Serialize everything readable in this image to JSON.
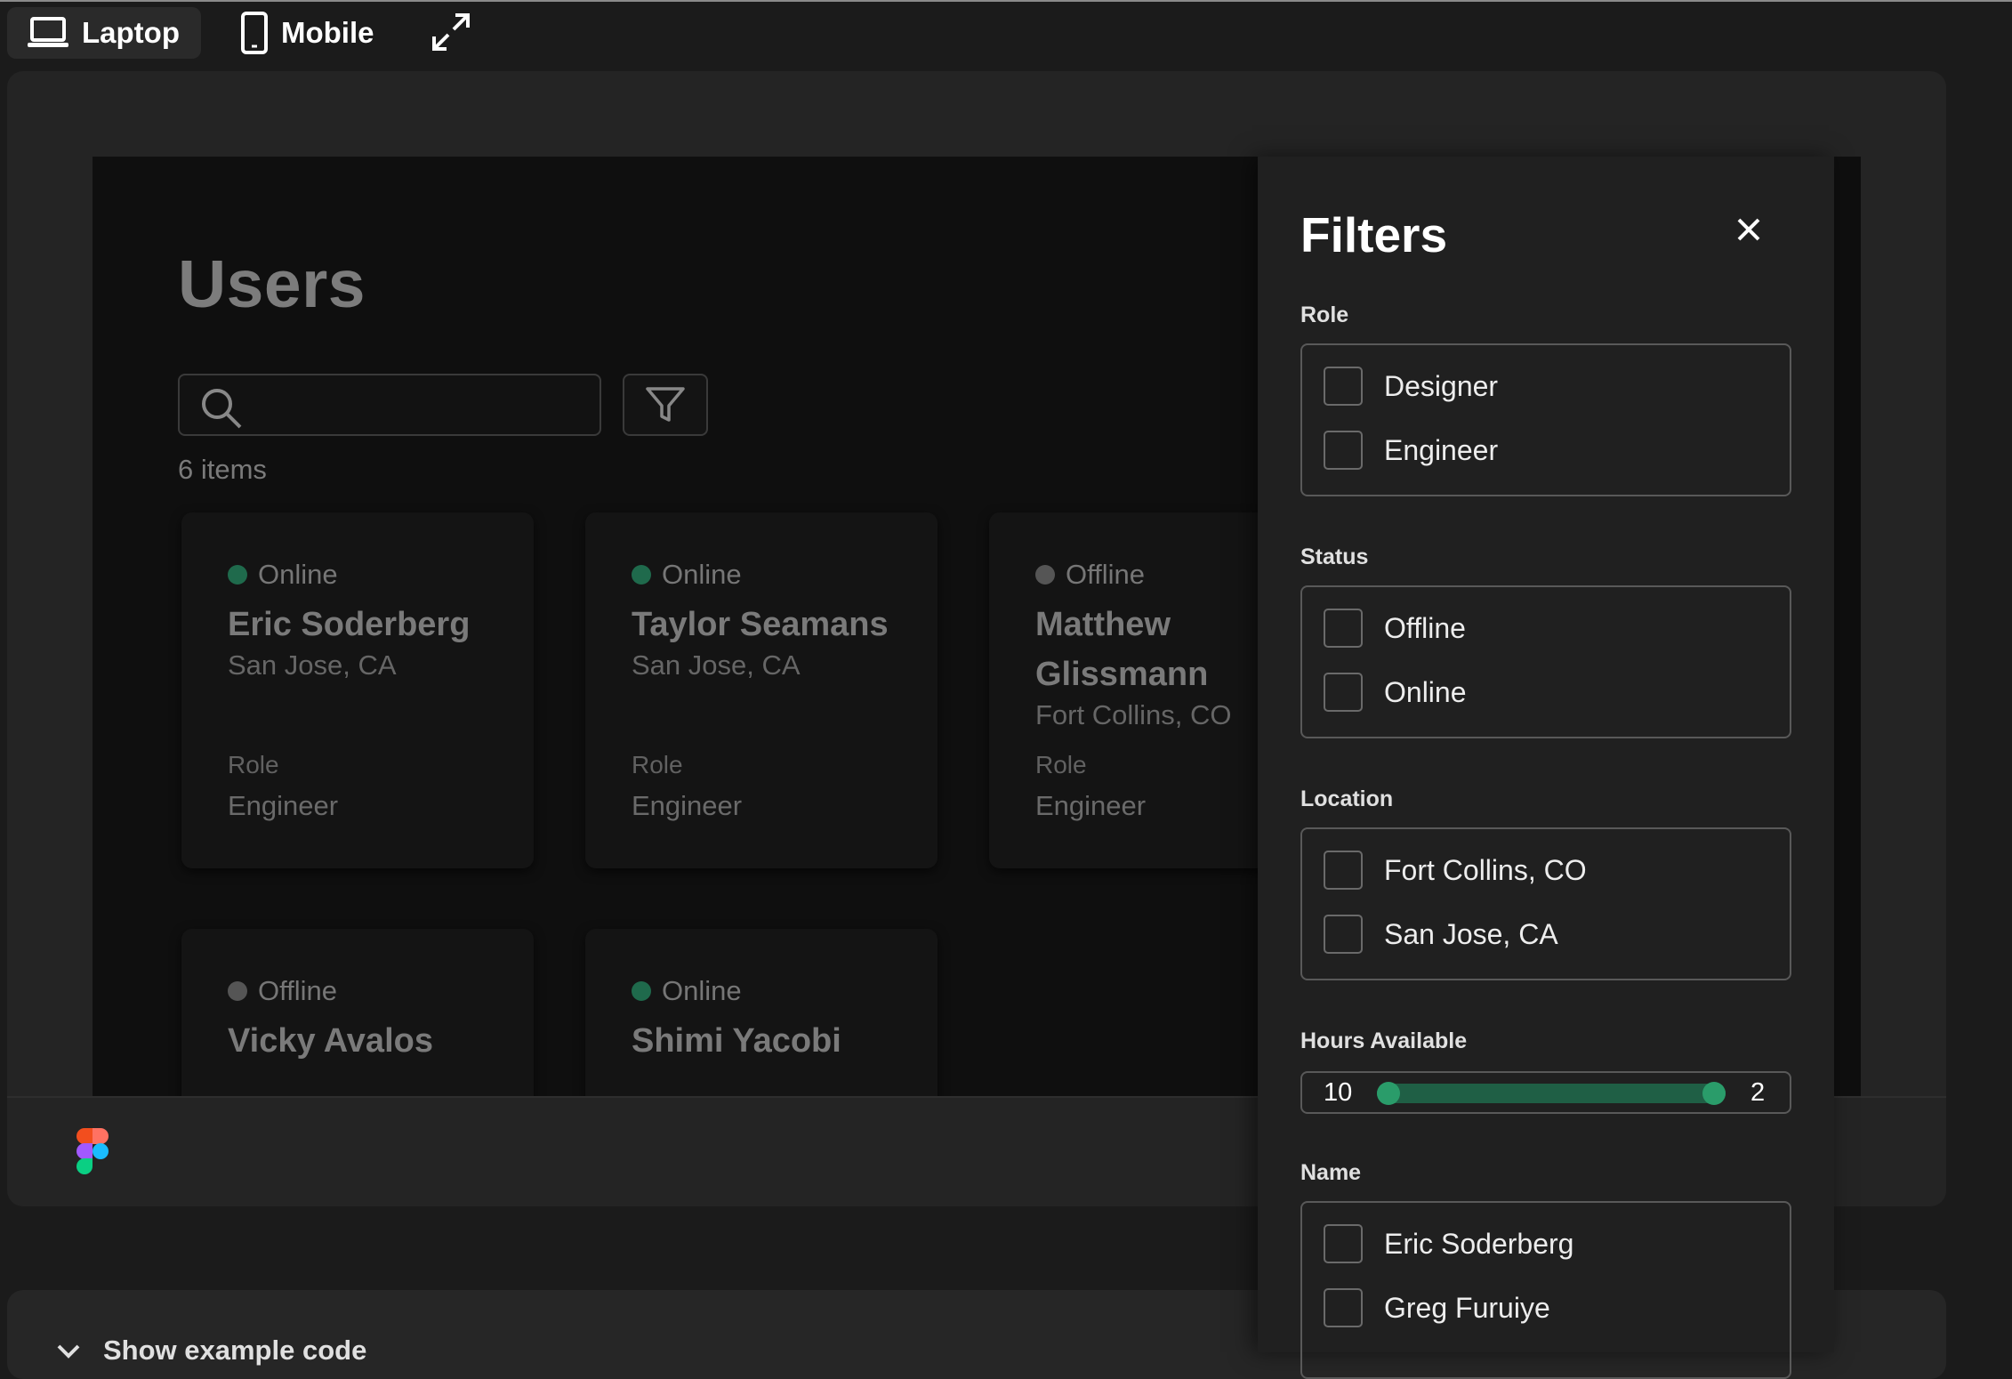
{
  "device_bar": {
    "laptop_label": "Laptop",
    "mobile_label": "Mobile"
  },
  "app": {
    "title": "Users",
    "search": {
      "value": "",
      "placeholder": ""
    },
    "items_count": "6 items",
    "users": [
      {
        "status": "Online",
        "name": "Eric Soderberg",
        "location": "San Jose, CA",
        "role_label": "Role",
        "role": "Engineer"
      },
      {
        "status": "Online",
        "name": "Taylor Seamans",
        "location": "San Jose, CA",
        "role_label": "Role",
        "role": "Engineer"
      },
      {
        "status": "Offline",
        "name": "Matthew Glissmann",
        "location": "Fort Collins, CO",
        "role_label": "Role",
        "role": "Engineer"
      },
      {
        "status": "Offline",
        "name": "Vicky Avalos"
      },
      {
        "status": "Online",
        "name": "Shimi Yacobi"
      }
    ]
  },
  "filters": {
    "title": "Filters",
    "role": {
      "label": "Role",
      "options": [
        "Designer",
        "Engineer"
      ]
    },
    "status": {
      "label": "Status",
      "options": [
        "Offline",
        "Online"
      ]
    },
    "location": {
      "label": "Location",
      "options": [
        "Fort Collins, CO",
        "San Jose, CA"
      ]
    },
    "hours": {
      "label": "Hours Available",
      "min": "10",
      "max": "2",
      "range_fill": 1.0
    },
    "name": {
      "label": "Name",
      "options": [
        "Eric Soderberg",
        "Greg Furuiye"
      ]
    }
  },
  "code_bar": {
    "label": "Show example code"
  },
  "colors": {
    "online": "#1f6a4c",
    "offline": "#555555",
    "slider_thumb": "#2a9c6a",
    "background": "#1b1b1b"
  }
}
